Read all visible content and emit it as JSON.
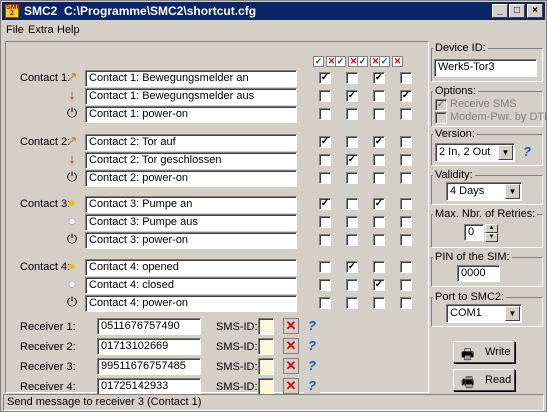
{
  "window": {
    "app_name": "SMC2",
    "title": "C:\\Programme\\SMC2\\shortcut.cfg",
    "icon_text": "SMC 2"
  },
  "menu": [
    "File",
    "Extra",
    "Help"
  ],
  "contacts": [
    {
      "label": "Contact 1:",
      "rows": [
        {
          "text": "Contact 1: Bewegungsmelder an",
          "icon": "motion-sensor-on-icon",
          "checks": [
            true,
            false,
            true,
            false
          ]
        },
        {
          "text": "Contact 1: Bewegungsmelder aus",
          "icon": "motion-sensor-off-icon",
          "checks": [
            false,
            true,
            false,
            true
          ]
        },
        {
          "text": "Contact 1: power-on",
          "icon": "power-icon",
          "checks": [
            false,
            false,
            false,
            false
          ]
        }
      ]
    },
    {
      "label": "Contact 2:",
      "rows": [
        {
          "text": "Contact 2: Tor auf",
          "icon": "motion-sensor-on-icon",
          "checks": [
            true,
            false,
            true,
            false
          ]
        },
        {
          "text": "Contact 2: Tor geschlossen",
          "icon": "motion-sensor-off-icon",
          "checks": [
            false,
            true,
            false,
            false
          ]
        },
        {
          "text": "Contact 2: power-on",
          "icon": "power-icon",
          "checks": [
            false,
            false,
            false,
            false
          ]
        }
      ]
    },
    {
      "label": "Contact 3:",
      "rows": [
        {
          "text": "Contact 3: Pumpe an",
          "icon": "bulb-on-icon",
          "checks": [
            true,
            false,
            true,
            false
          ]
        },
        {
          "text": "Contact 3: Pumpe aus",
          "icon": "bulb-off-icon",
          "checks": [
            false,
            false,
            false,
            false
          ]
        },
        {
          "text": "Contact 3: power-on",
          "icon": "power-icon",
          "checks": [
            false,
            false,
            false,
            false
          ]
        }
      ]
    },
    {
      "label": "Contact 4:",
      "rows": [
        {
          "text": "Contact 4: opened",
          "icon": "bulb-on-icon",
          "checks": [
            false,
            true,
            false,
            false
          ]
        },
        {
          "text": "Contact 4: closed",
          "icon": "bulb-off-icon",
          "checks": [
            false,
            false,
            true,
            false
          ]
        },
        {
          "text": "Contact 4: power-on",
          "icon": "power-icon",
          "checks": [
            false,
            false,
            false,
            false
          ]
        }
      ]
    }
  ],
  "receivers": [
    {
      "label": "Receiver 1:",
      "number": "0511676757490",
      "sms_id_label": "SMS-ID:"
    },
    {
      "label": "Receiver 2:",
      "number": "01713102669",
      "sms_id_label": "SMS-ID:"
    },
    {
      "label": "Receiver 3:",
      "number": "99511676757485",
      "sms_id_label": "SMS-ID:"
    },
    {
      "label": "Receiver 4:",
      "number": "01725142933",
      "sms_id_label": "SMS-ID:"
    }
  ],
  "right": {
    "device_id_label": "Device ID:",
    "device_id": "Werk5-Tor3",
    "options_label": "Options:",
    "option_receive_sms": "Receive SMS",
    "option_modem": "Modem-Pwr. by DTR",
    "version_label": "Version:",
    "version_value": "2 In, 2 Out",
    "validity_label": "Validity:",
    "validity_value": "4 Days",
    "max_retries_label": "Max. Nbr. of Retries:",
    "max_retries_value": "0",
    "pin_label": "PIN of the SIM:",
    "pin_value": "0000",
    "port_label": "Port to SMC2:",
    "port_value": "COM1",
    "write_label": "Write",
    "read_label": "Read"
  },
  "status": "Send message to receiver 3 (Contact 1)",
  "colors": {
    "title_bar": "#0a246a",
    "face": "#d4d0c8",
    "delete_red": "#dd0000",
    "help_blue": "#0060c0"
  }
}
